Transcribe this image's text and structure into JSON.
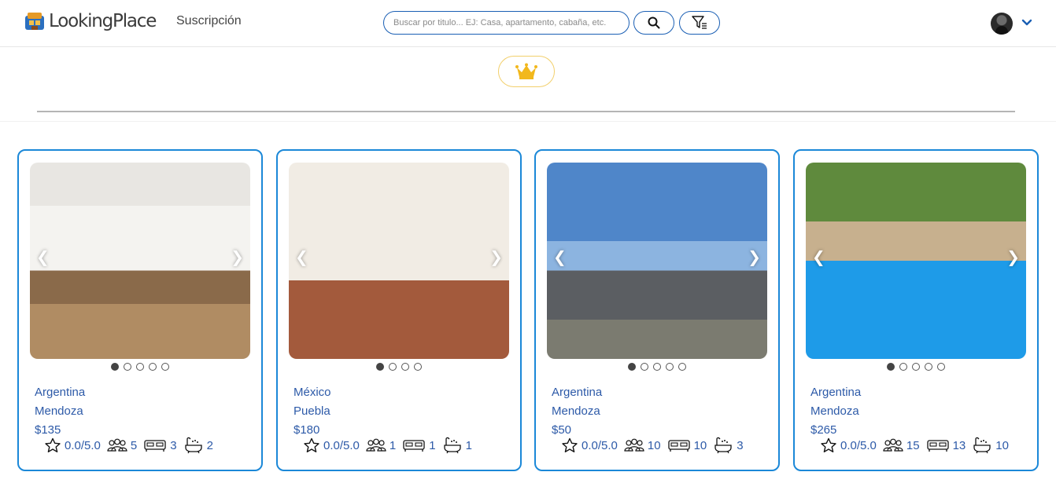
{
  "header": {
    "brand": "LookingPlace",
    "nav_subscription": "Suscripción",
    "search_placeholder": "Buscar por titulo... EJ: Casa, apartamento, cabaña, etc."
  },
  "listings": [
    {
      "country": "Argentina",
      "city": "Mendoza",
      "price": "$135",
      "rating": "0.0/5.0",
      "guests": "5",
      "beds": "3",
      "baths": "2",
      "photo_dots": 5,
      "active_dot": 0
    },
    {
      "country": "México",
      "city": "Puebla",
      "price": "$180",
      "rating": "0.0/5.0",
      "guests": "1",
      "beds": "1",
      "baths": "1",
      "photo_dots": 4,
      "active_dot": 0
    },
    {
      "country": "Argentina",
      "city": "Mendoza",
      "price": "$50",
      "rating": "0.0/5.0",
      "guests": "10",
      "beds": "10",
      "baths": "3",
      "photo_dots": 5,
      "active_dot": 0
    },
    {
      "country": "Argentina",
      "city": "Mendoza",
      "price": "$265",
      "rating": "0.0/5.0",
      "guests": "15",
      "beds": "13",
      "baths": "10",
      "photo_dots": 5,
      "active_dot": 0
    }
  ],
  "colors": {
    "accent": "#1b88d8",
    "text_link": "#2d5aa8",
    "crown": "#f2b81c"
  },
  "icons": [
    "logo-icon",
    "search-icon",
    "filter-icon",
    "chevron-down-icon",
    "crown-icon",
    "star-icon",
    "guests-icon",
    "bed-icon",
    "bath-icon"
  ]
}
